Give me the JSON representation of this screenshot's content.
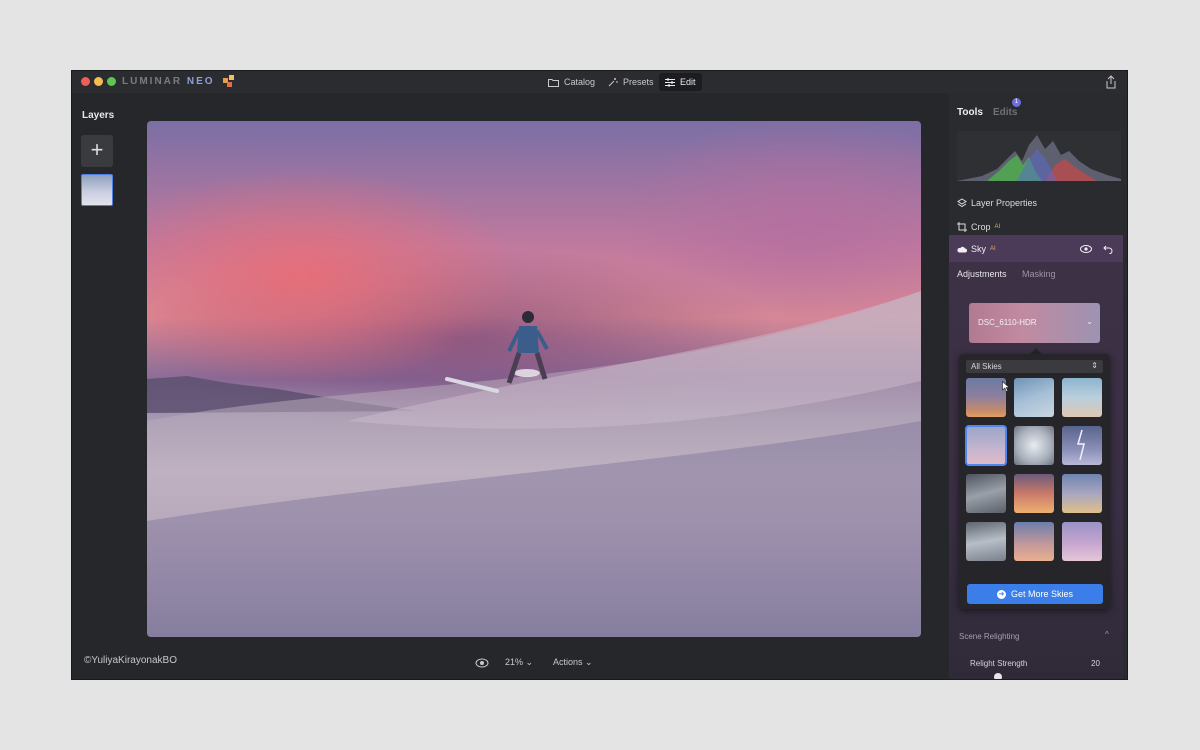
{
  "app": {
    "logo_text": "LUMINAR",
    "logo_suffix": "NEO",
    "nav": [
      {
        "label": "Catalog",
        "icon": "folder-icon"
      },
      {
        "label": "Presets",
        "icon": "magic-wand-icon"
      },
      {
        "label": "Edit",
        "icon": "sliders-icon",
        "active": true
      }
    ]
  },
  "layers": {
    "title": "Layers",
    "add_label": "+"
  },
  "canvas": {
    "watermark": "©YuliyaKirayonakBO",
    "zoom": "21%",
    "zoom_caret": "⌄",
    "actions": "Actions",
    "actions_caret": "⌄"
  },
  "panel": {
    "tab_tools": "Tools",
    "tab_edits": "Edits",
    "edits_badge": "1",
    "layer_properties": "Layer Properties",
    "crop": "Crop",
    "ai_mark": "AI",
    "sky": {
      "label": "Sky",
      "tab_adjustments": "Adjustments",
      "tab_masking": "Masking",
      "selected_sky": "DSC_6110-HDR",
      "selected_caret": "⌄",
      "filter": "All Skies",
      "filter_arrows": "⇕",
      "get_more": "Get More Skies",
      "get_more_icon": "➜"
    },
    "scene_relighting": "Scene Relighting",
    "scene_caret": "^",
    "relight_strength": "Relight Strength",
    "relight_value": "20"
  },
  "colors": {
    "accent": "#3b7ee9",
    "selection": "#4f86f0",
    "sky_header": "#4b3a58"
  }
}
